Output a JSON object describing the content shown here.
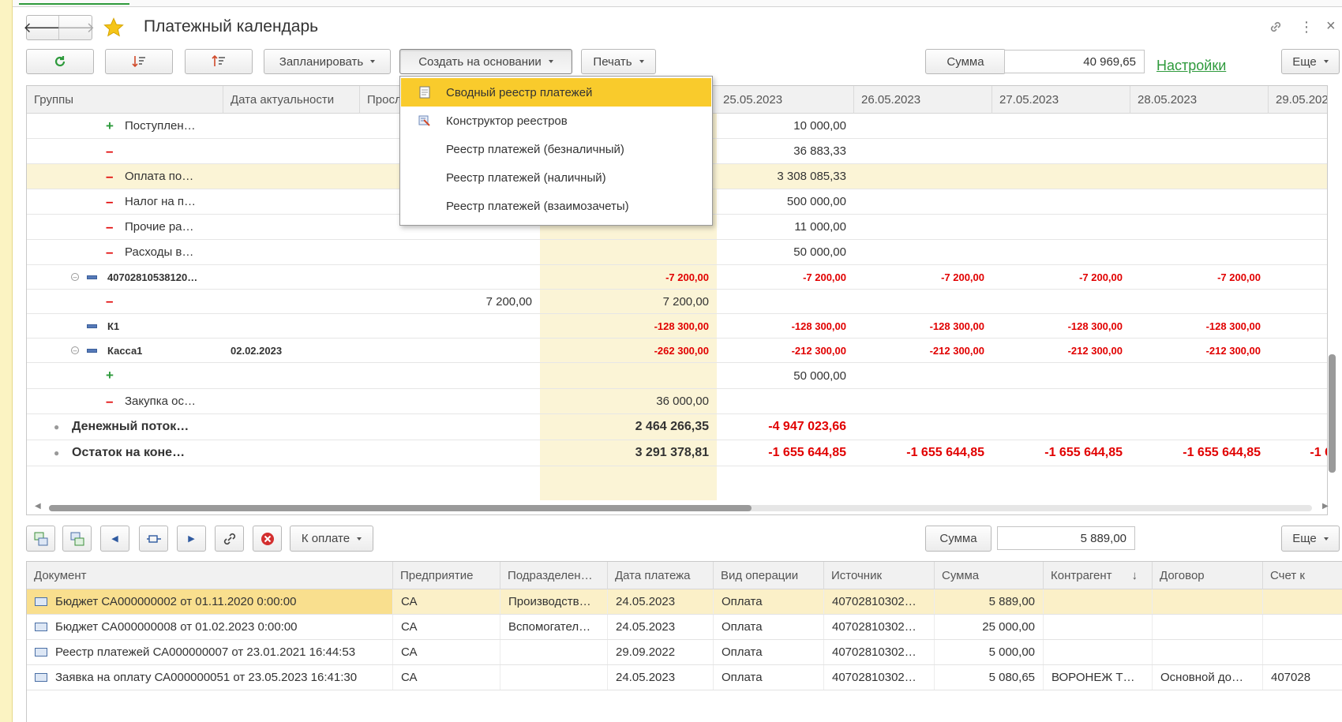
{
  "window": {
    "title": "Платежный календарь",
    "more_icon": "⋮",
    "close_icon": "×",
    "link_icon": "link-icon"
  },
  "toolbar": {
    "schedule_label": "Запланировать",
    "create_based_label": "Создать на основании",
    "print_label": "Печать",
    "sum_label": "Сумма",
    "sum_value": "40 969,65",
    "settings_label": "Настройки",
    "more_label": "Еще"
  },
  "dropdown_menu": {
    "items": [
      {
        "label": "Сводный реестр платежей",
        "icon": "document-icon"
      },
      {
        "label": "Конструктор реестров",
        "icon": "constructor-icon"
      },
      {
        "label": "Реестр платежей (безналичный)",
        "icon": ""
      },
      {
        "label": "Реестр платежей (наличный)",
        "icon": ""
      },
      {
        "label": "Реестр платежей (взаимозачеты)",
        "icon": ""
      }
    ]
  },
  "calendar_grid": {
    "columns": [
      "Группы",
      "Дата актуальности",
      "Просл",
      "25.05.2023",
      "26.05.2023",
      "27.05.2023",
      "28.05.2023",
      "29.05.202"
    ],
    "rows": [
      {
        "marker": "+",
        "name": "Поступлен…",
        "date": "",
        "overdue": "",
        "today": "",
        "d1": "10 000,00",
        "d2": "",
        "d3": "",
        "d4": "",
        "d5": ""
      },
      {
        "marker": "–",
        "name": "",
        "date": "",
        "overdue": "",
        "today": "",
        "d1": "36 883,33",
        "d2": "",
        "d3": "",
        "d4": "",
        "d5": ""
      },
      {
        "marker": "–",
        "name": "Оплата по…",
        "date": "",
        "overdue": "",
        "today": "",
        "d1": "3 308 085,33",
        "d2": "",
        "d3": "",
        "d4": "",
        "d5": ""
      },
      {
        "marker": "–",
        "name": "Налог на п…",
        "date": "",
        "overdue": "",
        "today": "",
        "d1": "500 000,00",
        "d2": "",
        "d3": "",
        "d4": "",
        "d5": ""
      },
      {
        "marker": "–",
        "name": "Прочие ра…",
        "date": "",
        "overdue": "",
        "today": "",
        "d1": "11 000,00",
        "d2": "",
        "d3": "",
        "d4": "",
        "d5": ""
      },
      {
        "marker": "–",
        "name": "Расходы в…",
        "date": "",
        "overdue": "",
        "today": "",
        "d1": "50 000,00",
        "d2": "",
        "d3": "",
        "d4": "",
        "d5": ""
      },
      {
        "marker": "⊖",
        "name": "40702810538120…",
        "date": "",
        "overdue": "",
        "today": "-7 200,00",
        "d1": "-7 200,00",
        "d2": "-7 200,00",
        "d3": "-7 200,00",
        "d4": "-7 200,00",
        "d5": ""
      },
      {
        "marker": "–",
        "name": "",
        "date": "",
        "overdue": "7 200,00",
        "today": "7 200,00",
        "d1": "",
        "d2": "",
        "d3": "",
        "d4": "",
        "d5": ""
      },
      {
        "marker": "",
        "name": "К1",
        "date": "",
        "overdue": "",
        "today": "-128 300,00",
        "d1": "-128 300,00",
        "d2": "-128 300,00",
        "d3": "-128 300,00",
        "d4": "-128 300,00",
        "d5": ""
      },
      {
        "marker": "⊖",
        "name": "Касса1",
        "date": "02.02.2023",
        "overdue": "",
        "today": "-262 300,00",
        "d1": "-212 300,00",
        "d2": "-212 300,00",
        "d3": "-212 300,00",
        "d4": "-212 300,00",
        "d5": ""
      },
      {
        "marker": "+",
        "name": "",
        "date": "",
        "overdue": "",
        "today": "",
        "d1": "50 000,00",
        "d2": "",
        "d3": "",
        "d4": "",
        "d5": ""
      },
      {
        "marker": "–",
        "name": "Закупка ос…",
        "date": "",
        "overdue": "",
        "today": "36 000,00",
        "d1": "",
        "d2": "",
        "d3": "",
        "d4": "",
        "d5": ""
      },
      {
        "marker": "•",
        "name": "Денежный поток…",
        "date": "",
        "overdue": "",
        "today": "2 464 266,35",
        "d1": "-4 947 023,66",
        "d2": "",
        "d3": "",
        "d4": "",
        "d5": ""
      },
      {
        "marker": "•",
        "name": "Остаток на коне…",
        "date": "",
        "overdue": "",
        "today": "3 291 378,81",
        "d1": "-1 655 644,85",
        "d2": "-1 655 644,85",
        "d3": "-1 655 644,85",
        "d4": "-1 655 644,85",
        "d5": "-1 6"
      }
    ]
  },
  "bottom_toolbar": {
    "to_pay_label": "К оплате",
    "sum_label": "Сумма",
    "sum_value": "5 889,00",
    "more_label": "Еще"
  },
  "documents_grid": {
    "columns": [
      "Документ",
      "Предприятие",
      "Подразделен…",
      "Дата платежа",
      "Вид операции",
      "Источник",
      "Сумма",
      "Контрагент",
      "Договор",
      "Счет к"
    ],
    "sort_indicator": "↓",
    "rows": [
      {
        "doc": "Бюджет СА000000002 от 01.11.2020 0:00:00",
        "org": "СА",
        "dept": "Производств…",
        "date": "24.05.2023",
        "op": "Оплата",
        "source": "40702810302…",
        "sum": "5 889,00",
        "contractor": "",
        "contract": "",
        "account": ""
      },
      {
        "doc": "Бюджет СА000000008 от 01.02.2023 0:00:00",
        "org": "СА",
        "dept": "Вспомогател…",
        "date": "24.05.2023",
        "op": "Оплата",
        "source": "40702810302…",
        "sum": "25 000,00",
        "contractor": "",
        "contract": "",
        "account": ""
      },
      {
        "doc": "Реестр платежей СА000000007 от 23.01.2021 16:44:53",
        "org": "СА",
        "dept": "",
        "date": "29.09.2022",
        "op": "Оплата",
        "source": "40702810302…",
        "sum": "5 000,00",
        "contractor": "",
        "contract": "",
        "account": ""
      },
      {
        "doc": "Заявка на оплату СА000000051 от 23.05.2023 16:41:30",
        "org": "СА",
        "dept": "",
        "date": "24.05.2023",
        "op": "Оплата",
        "source": "40702810302…",
        "sum": "5 080,65",
        "contractor": "ВОРОНЕЖ Т…",
        "contract": "Основной до…",
        "account": "407028"
      }
    ]
  },
  "colors": {
    "accent_green": "#2e9a3c",
    "negative_red": "#e10000",
    "menu_highlight": "#f9cb2c",
    "selected_row": "#fbf4d6",
    "today_column": "#fbf4d6"
  }
}
